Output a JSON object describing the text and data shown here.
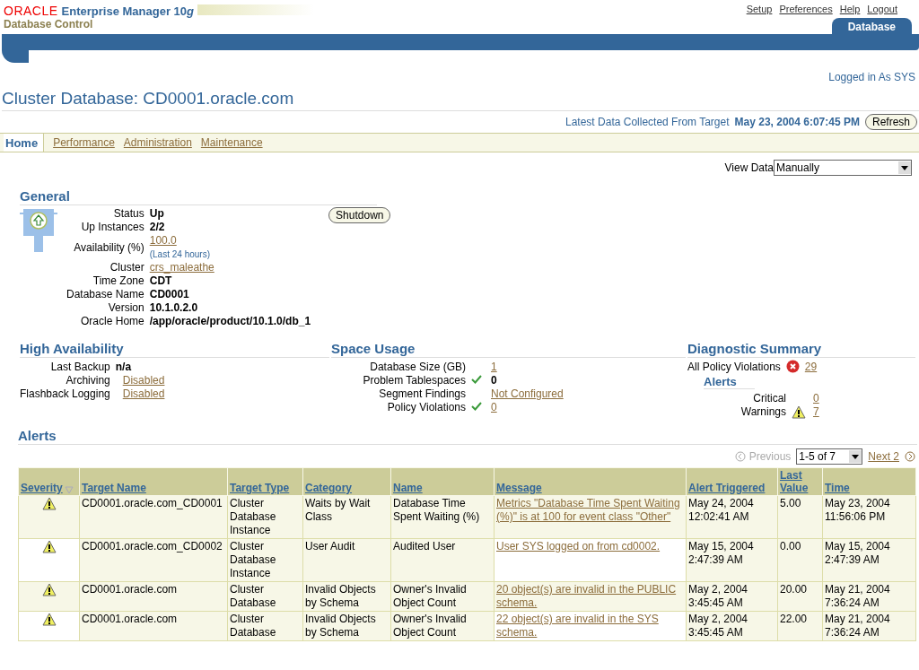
{
  "header": {
    "brand": "ORACLE",
    "product": "Enterprise Manager 10",
    "product_suffix": "g",
    "subtitle": "Database Control",
    "global_links": [
      "Setup",
      "Preferences",
      "Help",
      "Logout"
    ],
    "tabs": [
      {
        "label": "Database",
        "selected": true
      }
    ]
  },
  "user_info": "Logged in As SYS",
  "page_title": "Cluster Database: CD0001.oracle.com",
  "data_collected": {
    "label": "Latest Data Collected From Target",
    "timestamp": "May 23, 2004 6:07:45 PM",
    "button": "Refresh"
  },
  "subtabs": [
    {
      "label": "Home",
      "selected": true
    },
    {
      "label": "Performance",
      "selected": false
    },
    {
      "label": "Administration",
      "selected": false
    },
    {
      "label": "Maintenance",
      "selected": false
    }
  ],
  "view_data": {
    "label": "View Data",
    "value": "Manually"
  },
  "general": {
    "title": "General",
    "button": "Shutdown",
    "fields": [
      {
        "label": "Status",
        "value": "Up",
        "kind": "bold"
      },
      {
        "label": "Up Instances",
        "value": "2/2",
        "kind": "bold"
      },
      {
        "label": "Availability (%)",
        "value": "100.0",
        "kind": "link",
        "note": "(Last 24 hours)"
      },
      {
        "label": "Cluster",
        "value": "crs_maleathe",
        "kind": "link"
      },
      {
        "label": "Time Zone",
        "value": "CDT",
        "kind": "bold"
      },
      {
        "label": "Database Name",
        "value": "CD0001",
        "kind": "bold"
      },
      {
        "label": "Version",
        "value": "10.1.0.2.0",
        "kind": "bold"
      },
      {
        "label": "Oracle Home",
        "value": "/app/oracle/product/10.1.0/db_1",
        "kind": "bold"
      }
    ]
  },
  "high_availability": {
    "title": "High Availability",
    "fields": [
      {
        "label": "Last Backup",
        "value": "n/a",
        "kind": "bold"
      },
      {
        "label": "Archiving",
        "value": "Disabled",
        "kind": "link"
      },
      {
        "label": "Flashback Logging",
        "value": "Disabled",
        "kind": "link"
      }
    ]
  },
  "space_usage": {
    "title": "Space Usage",
    "fields": [
      {
        "label": "Database Size (GB)",
        "value": "1",
        "kind": "link",
        "ok": false
      },
      {
        "label": "Problem Tablespaces",
        "value": "0",
        "kind": "bold",
        "ok": true
      },
      {
        "label": "Segment Findings",
        "value": "Not Configured",
        "kind": "link",
        "ok": false
      },
      {
        "label": "Policy Violations",
        "value": "0",
        "kind": "link",
        "ok": true
      }
    ]
  },
  "diagnostic_summary": {
    "title": "Diagnostic Summary",
    "policy_violations": {
      "label": "All Policy Violations",
      "value": "29",
      "critical": true
    },
    "alerts": {
      "title": "Alerts",
      "items": [
        {
          "label": "Critical",
          "value": "0",
          "warning": false
        },
        {
          "label": "Warnings",
          "value": "7",
          "warning": true
        }
      ]
    }
  },
  "alerts": {
    "title": "Alerts",
    "pagination": {
      "previous": "Previous",
      "previous_disabled": true,
      "range": "1-5 of 7",
      "next": "Next 2"
    },
    "columns": [
      {
        "label": "Severity",
        "sorted": true
      },
      {
        "label": "Target Name",
        "sorted": false
      },
      {
        "label": "Target Type",
        "sorted": false
      },
      {
        "label": "Category",
        "sorted": false
      },
      {
        "label": "Name",
        "sorted": false
      },
      {
        "label": "Message",
        "sorted": false
      },
      {
        "label": "Alert Triggered",
        "sorted": false
      },
      {
        "label": "Last Value",
        "sorted": false
      },
      {
        "label": "Time",
        "sorted": false
      }
    ],
    "rows": [
      {
        "warning": true,
        "target_name": "CD0001.oracle.com_CD0001",
        "target_type": "Cluster Database Instance",
        "category": "Waits by Wait Class",
        "name": "Database Time Spent Waiting (%)",
        "message": "Metrics \"Database Time Spent Waiting (%)\" is at 100 for event class \"Other\"",
        "alert_triggered": "May 24, 2004 12:02:41 AM",
        "last_value": "5.00",
        "time": "May 23, 2004 11:56:06 PM"
      },
      {
        "warning": true,
        "target_name": "CD0001.oracle.com_CD0002",
        "target_type": "Cluster Database Instance",
        "category": "User Audit",
        "name": "Audited User",
        "message": "User SYS logged on from cd0002.",
        "alert_triggered": "May 15, 2004 2:47:39 AM",
        "last_value": "0.00",
        "time": "May 15, 2004 2:47:39 AM"
      },
      {
        "warning": true,
        "target_name": "CD0001.oracle.com",
        "target_type": "Cluster Database",
        "category": "Invalid Objects by Schema",
        "name": "Owner's Invalid Object Count",
        "message": "20 object(s) are invalid in the PUBLIC schema.",
        "alert_triggered": "May 2, 2004 3:45:45 AM",
        "last_value": "20.00",
        "time": "May 21, 2004 7:36:24 AM"
      },
      {
        "warning": true,
        "target_name": "CD0001.oracle.com",
        "target_type": "Cluster Database",
        "category": "Invalid Objects by Schema",
        "name": "Owner's Invalid Object Count",
        "message": "22 object(s) are invalid in the SYS schema.",
        "alert_triggered": "May 2, 2004 3:45:45 AM",
        "last_value": "22.00",
        "time": "May 21, 2004 7:36:24 AM"
      }
    ]
  }
}
